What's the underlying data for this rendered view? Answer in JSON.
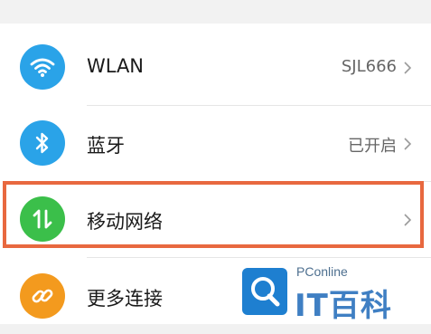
{
  "settings": {
    "items": [
      {
        "label": "WLAN",
        "value": "SJL666",
        "icon": "wifi-icon",
        "color": "#2aa3e8"
      },
      {
        "label": "蓝牙",
        "value": "已开启",
        "icon": "bluetooth-icon",
        "color": "#2aa3e8"
      },
      {
        "label": "移动网络",
        "value": "",
        "icon": "mobile-data-icon",
        "color": "#3bbf4a"
      },
      {
        "label": "更多连接",
        "value": "",
        "icon": "link-icon",
        "color": "#f39a1e"
      }
    ]
  },
  "highlight": {
    "color": "#e8683f"
  },
  "watermark": {
    "brand": "PConline",
    "name": "IT百科",
    "color": "#3f7fc3"
  }
}
